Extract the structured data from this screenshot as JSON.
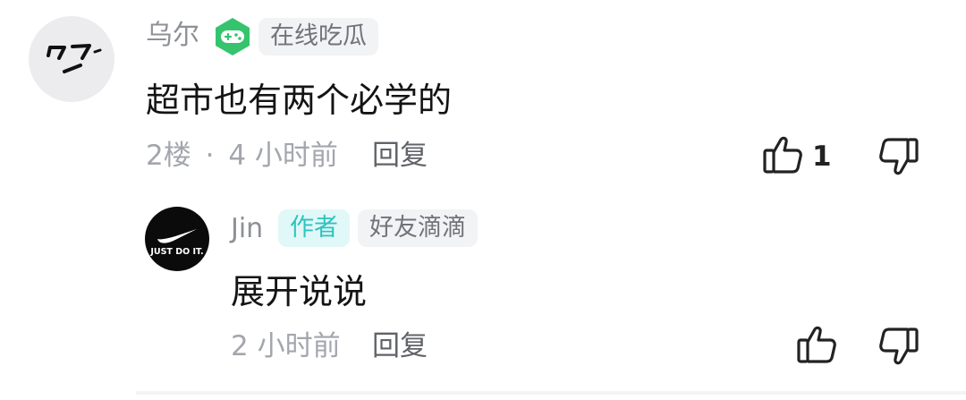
{
  "comment": {
    "username": "乌尔",
    "badge_icon": "game-controller-hexagon-icon",
    "badge_color": "#35c46d",
    "tag": "在线吃瓜",
    "text": "超市也有两个必学的",
    "floor": "2楼",
    "separator": "·",
    "time": "4 小时前",
    "reply_label": "回复",
    "like_count": "1"
  },
  "reply": {
    "username": "Jin",
    "author_tag": "作者",
    "tag": "好友滴滴",
    "avatar_text": "JUST DO IT.",
    "text": "展开说说",
    "time": "2 小时前",
    "reply_label": "回复",
    "like_count": ""
  },
  "colors": {
    "author_tag_bg": "#e0f8f7",
    "author_tag_text": "#2fc3c0"
  }
}
